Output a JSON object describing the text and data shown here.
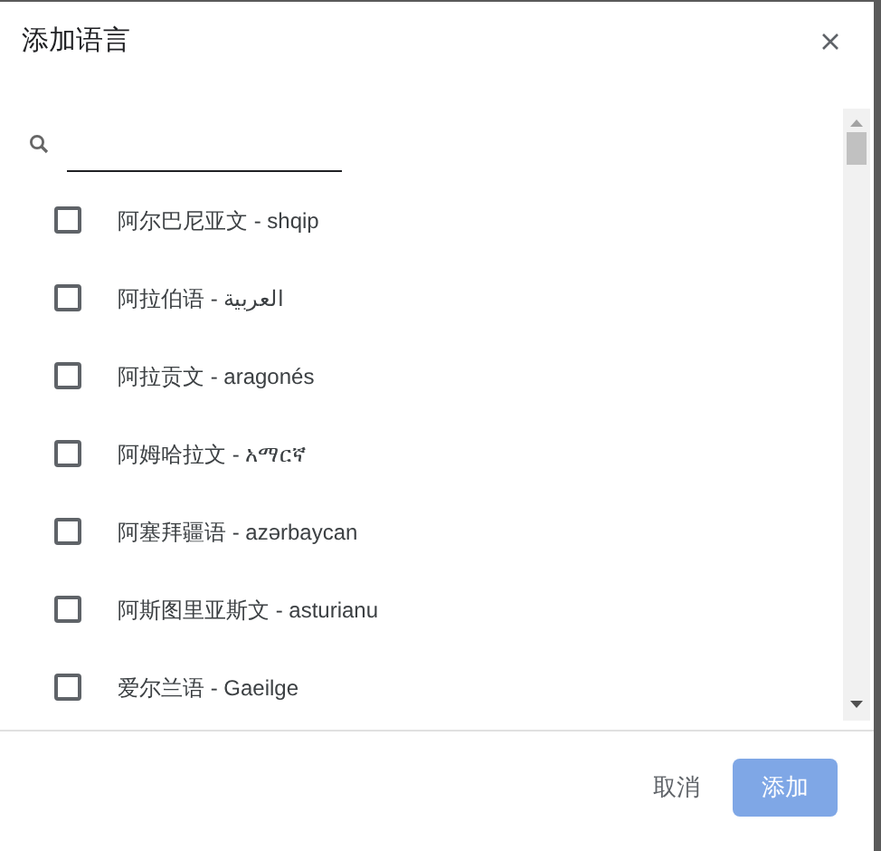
{
  "dialog": {
    "title": "添加语言"
  },
  "languages": [
    {
      "label": "阿尔巴尼亚文 - shqip",
      "checked": false
    },
    {
      "label": "阿拉伯语 - العربية",
      "checked": false
    },
    {
      "label": "阿拉贡文 - aragonés",
      "checked": false
    },
    {
      "label": "阿姆哈拉文 - አማርኛ",
      "checked": false
    },
    {
      "label": "阿塞拜疆语 - azərbaycan",
      "checked": false
    },
    {
      "label": "阿斯图里亚斯文 - asturianu",
      "checked": false
    },
    {
      "label": "爱尔兰语 - Gaeilge",
      "checked": false
    }
  ],
  "buttons": [
    {
      "label": "取消",
      "kind": "text",
      "disabled": false
    },
    {
      "label": "添加",
      "kind": "primary",
      "disabled": true
    }
  ]
}
